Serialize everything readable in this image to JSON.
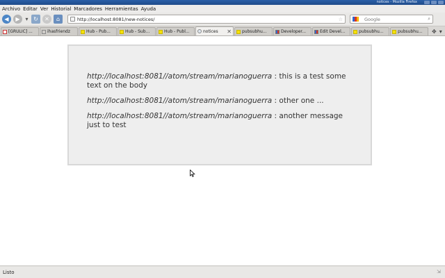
{
  "window": {
    "title": "notices - Mozilla Firefox"
  },
  "menu": {
    "items": [
      "Archivo",
      "Editar",
      "Ver",
      "Historial",
      "Marcadores",
      "Herramientas",
      "Ayuda"
    ]
  },
  "toolbar": {
    "back_icon": "back-arrow-icon",
    "forward_icon": "forward-arrow-icon",
    "reload_icon": "reload-icon",
    "stop_icon": "stop-icon",
    "home_icon": "home-icon",
    "url": "http://localhost:8081/new-notices/",
    "search_placeholder": "Google"
  },
  "tabs": [
    {
      "label": "[GRULIC] ...",
      "icon": "gmail-icon",
      "active": false
    },
    {
      "label": "ihasfriendz",
      "icon": "page-icon",
      "active": false
    },
    {
      "label": "Hub - Pub...",
      "icon": "yellow-square-icon",
      "active": false
    },
    {
      "label": "Hub - Sub...",
      "icon": "yellow-square-icon",
      "active": false
    },
    {
      "label": "Hub - Publ...",
      "icon": "yellow-square-icon",
      "active": false
    },
    {
      "label": "notices",
      "icon": "globe-icon",
      "active": true
    },
    {
      "label": "pubsubhu...",
      "icon": "yellow-square-icon",
      "active": false
    },
    {
      "label": "Developer...",
      "icon": "google-icon",
      "active": false
    },
    {
      "label": "Edit Devel...",
      "icon": "google-icon",
      "active": false
    },
    {
      "label": "pubsubhu...",
      "icon": "yellow-square-icon",
      "active": false
    },
    {
      "label": "pubsubhu...",
      "icon": "yellow-square-icon",
      "active": false
    }
  ],
  "notices": [
    {
      "source": "http://localhost:8081//atom/stream/marianoguerra",
      "separator": " : ",
      "message": "this is a test some text on the body"
    },
    {
      "source": "http://localhost:8081//atom/stream/marianoguerra",
      "separator": " : ",
      "message": "other one ..."
    },
    {
      "source": "http://localhost:8081//atom/stream/marianoguerra",
      "separator": " : ",
      "message": "another message just to test"
    }
  ],
  "status": {
    "text": "Listo"
  }
}
